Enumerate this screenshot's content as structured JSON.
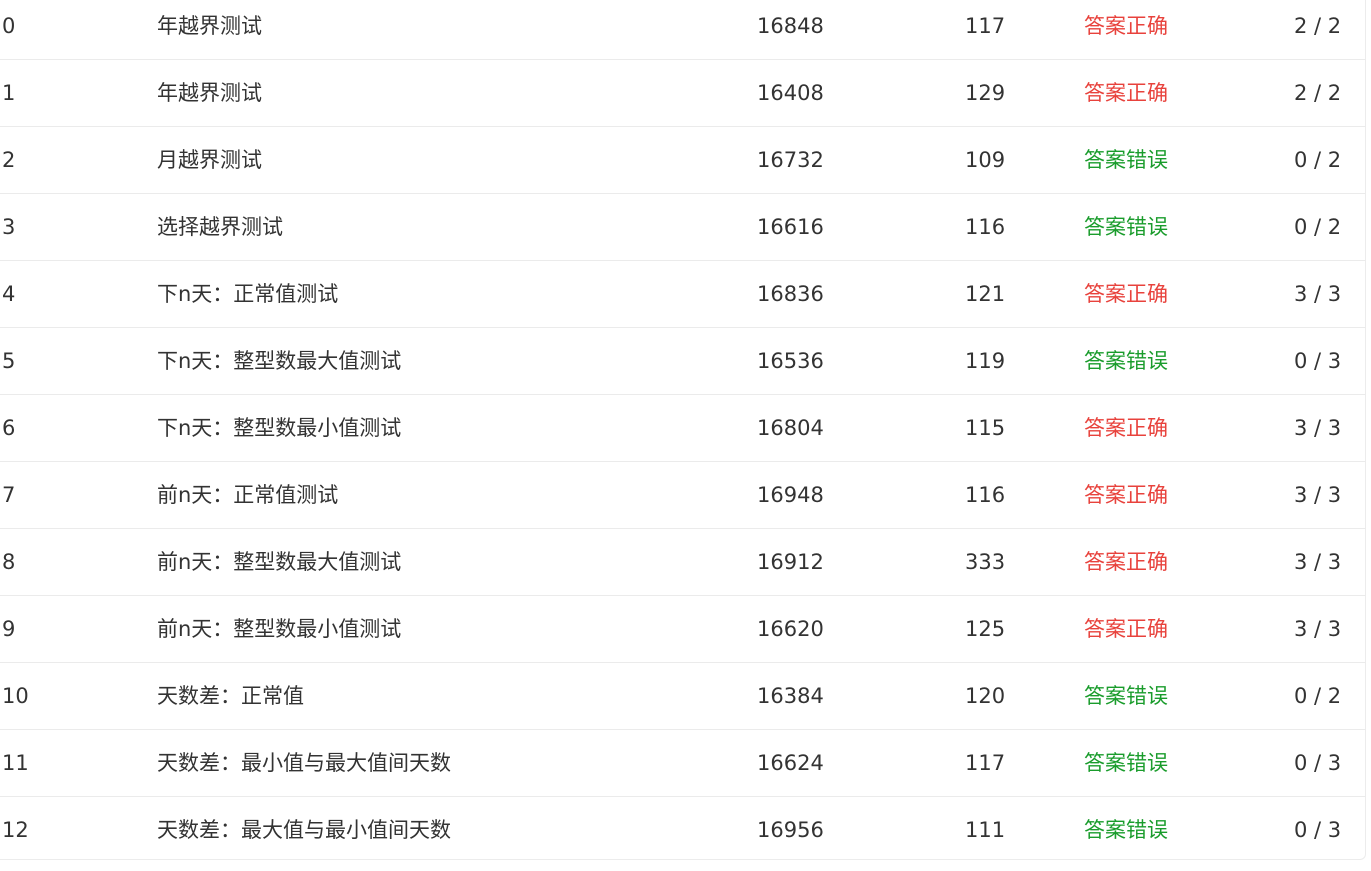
{
  "status_colors": {
    "答案正确": "#e8423c",
    "答案错误": "#1a9c2c"
  },
  "rows": [
    {
      "index": "0",
      "name": "年越界测试",
      "time": "16848",
      "memory": "117",
      "status": "答案正确",
      "score": "2 / 2"
    },
    {
      "index": "1",
      "name": "年越界测试",
      "time": "16408",
      "memory": "129",
      "status": "答案正确",
      "score": "2 / 2"
    },
    {
      "index": "2",
      "name": "月越界测试",
      "time": "16732",
      "memory": "109",
      "status": "答案错误",
      "score": "0 / 2"
    },
    {
      "index": "3",
      "name": "选择越界测试",
      "time": "16616",
      "memory": "116",
      "status": "答案错误",
      "score": "0 / 2"
    },
    {
      "index": "4",
      "name": "下n天：正常值测试",
      "time": "16836",
      "memory": "121",
      "status": "答案正确",
      "score": "3 / 3"
    },
    {
      "index": "5",
      "name": "下n天：整型数最大值测试",
      "time": "16536",
      "memory": "119",
      "status": "答案错误",
      "score": "0 / 3"
    },
    {
      "index": "6",
      "name": "下n天：整型数最小值测试",
      "time": "16804",
      "memory": "115",
      "status": "答案正确",
      "score": "3 / 3"
    },
    {
      "index": "7",
      "name": "前n天：正常值测试",
      "time": "16948",
      "memory": "116",
      "status": "答案正确",
      "score": "3 / 3"
    },
    {
      "index": "8",
      "name": "前n天：整型数最大值测试",
      "time": "16912",
      "memory": "333",
      "status": "答案正确",
      "score": "3 / 3"
    },
    {
      "index": "9",
      "name": "前n天：整型数最小值测试",
      "time": "16620",
      "memory": "125",
      "status": "答案正确",
      "score": "3 / 3"
    },
    {
      "index": "10",
      "name": "天数差：正常值",
      "time": "16384",
      "memory": "120",
      "status": "答案错误",
      "score": "0 / 2"
    },
    {
      "index": "11",
      "name": "天数差：最小值与最大值间天数",
      "time": "16624",
      "memory": "117",
      "status": "答案错误",
      "score": "0 / 3"
    },
    {
      "index": "12",
      "name": "天数差：最大值与最小值间天数",
      "time": "16956",
      "memory": "111",
      "status": "答案错误",
      "score": "0 / 3"
    }
  ]
}
